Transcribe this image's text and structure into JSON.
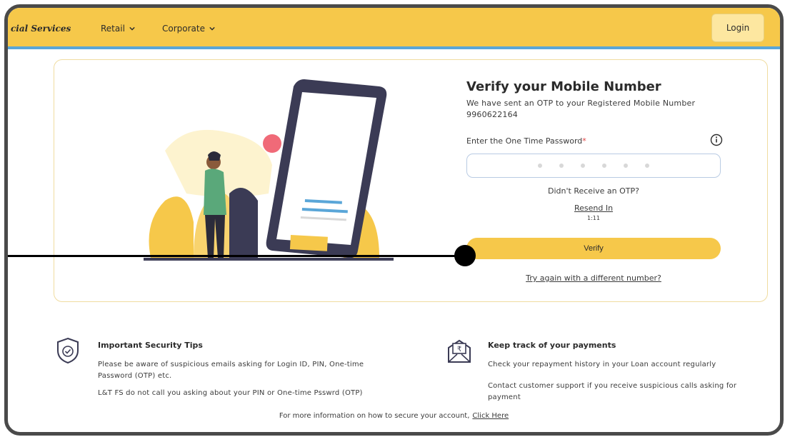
{
  "header": {
    "brand": "cial Services",
    "nav": [
      {
        "label": "Retail"
      },
      {
        "label": "Corporate"
      }
    ],
    "login_label": "Login"
  },
  "verify": {
    "title": "Verify your Mobile Number",
    "subtitle": "We have sent an OTP to your Registered Mobile Number",
    "mobile": "9960622164",
    "otp_label": "Enter the One Time Password",
    "required_mark": "*",
    "didnt_receive": "Didn't Receive an OTP?",
    "resend_label": "Resend In",
    "timer": "1:11",
    "verify_label": "Verify",
    "try_again": "Try again with a different number?"
  },
  "tips": {
    "security": {
      "title": "Important Security Tips",
      "line1": "Please be aware of suspicious emails asking for Login ID, PIN, One-time Password (OTP) etc.",
      "line2": "L&T FS do not call you asking about your PIN or One-time Psswrd (OTP)"
    },
    "payments": {
      "title": "Keep track of your payments",
      "line1": "Check your repayment history in your Loan account regularly",
      "line2": "Contact customer support if you receive suspicious calls asking for payment"
    }
  },
  "footer": {
    "note": "For more information on how to secure your account,",
    "link": "Click Here"
  },
  "colors": {
    "accent": "#f6c84a",
    "header_border": "#5aa6d8",
    "required": "#e04040"
  }
}
